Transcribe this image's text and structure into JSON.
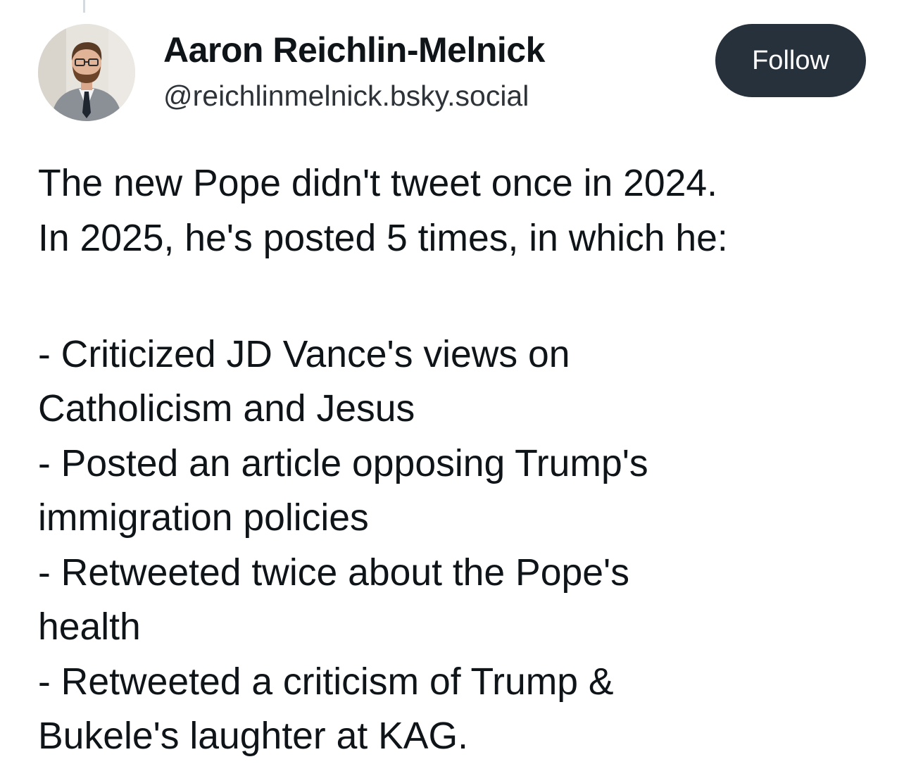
{
  "post": {
    "author": {
      "name": "Aaron Reichlin-Melnick",
      "handle": "@reichlinmelnick.bsky.social",
      "avatar_icon": "person-photo-avatar"
    },
    "follow_label": "Follow",
    "text_lines": [
      "The new Pope didn't tweet once in 2024.",
      "In 2025, he's posted 5 times, in which he:",
      "",
      "- Criticized JD Vance's views on",
      "Catholicism and Jesus",
      "- Posted an article opposing Trump's",
      "immigration policies",
      "- Retweeted twice about the Pope's",
      "health",
      "- Retweeted a criticism of Trump &",
      "Bukele's laughter at KAG."
    ]
  },
  "colors": {
    "follow_button_bg": "#26313c",
    "follow_button_text": "#ffffff",
    "text": "#0f1419",
    "handle_text": "#2d3338",
    "thread_line": "#d5dade"
  }
}
